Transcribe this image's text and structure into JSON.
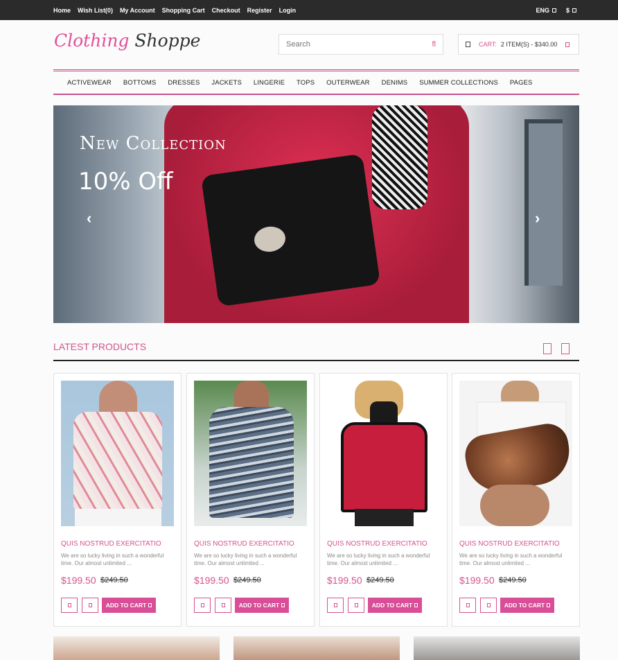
{
  "topbar": {
    "links": [
      "Home",
      "Wish List(0)",
      "My Account",
      "Shopping Cart",
      "Checkout",
      "Register",
      "Login"
    ],
    "language": "ENG",
    "currency": "$"
  },
  "logo": {
    "part1": "Clothing",
    "part2": "Shoppe"
  },
  "search": {
    "placeholder": "Search"
  },
  "cart": {
    "label": "CART:",
    "value": "2 ITEM(S) - $340.00"
  },
  "nav": {
    "items": [
      "ACTIVEWEAR",
      "BOTTOMS",
      "DRESSES",
      "JACKETS",
      "LINGERIE",
      "TOPS",
      "OUTERWEAR",
      "DENIMS",
      "SUMMER COLLECTIONS",
      "PAGES"
    ]
  },
  "banner": {
    "title": "New Collection",
    "offer": "10% Off"
  },
  "latest": {
    "title": "LATEST PRODUCTS",
    "products": [
      {
        "name": "QUIS NOSTRUD EXERCITATIO",
        "desc": "We are so lucky living in such a wonderful time. Our almost unlimited ...",
        "price": "$199.50",
        "old_price": "$249.50",
        "cta": "ADD TO CART"
      },
      {
        "name": "QUIS NOSTRUD EXERCITATIO",
        "desc": "We are so lucky living in such a wonderful time. Our almost unlimited ...",
        "price": "$199.50",
        "old_price": "$249.50",
        "cta": "ADD TO CART"
      },
      {
        "name": "QUIS NOSTRUD EXERCITATIO",
        "desc": "We are so lucky living in such a wonderful time. Our almost unlimited ...",
        "price": "$199.50",
        "old_price": "$249.50",
        "cta": "ADD TO CART"
      },
      {
        "name": "QUIS NOSTRUD EXERCITATIO",
        "desc": "We are so lucky living in such a wonderful time. Our almost unlimited ...",
        "price": "$199.50",
        "old_price": "$249.50",
        "cta": "ADD TO CART"
      }
    ]
  },
  "colors": {
    "accent": "#d4528f",
    "topbar": "#2b2b2b"
  }
}
